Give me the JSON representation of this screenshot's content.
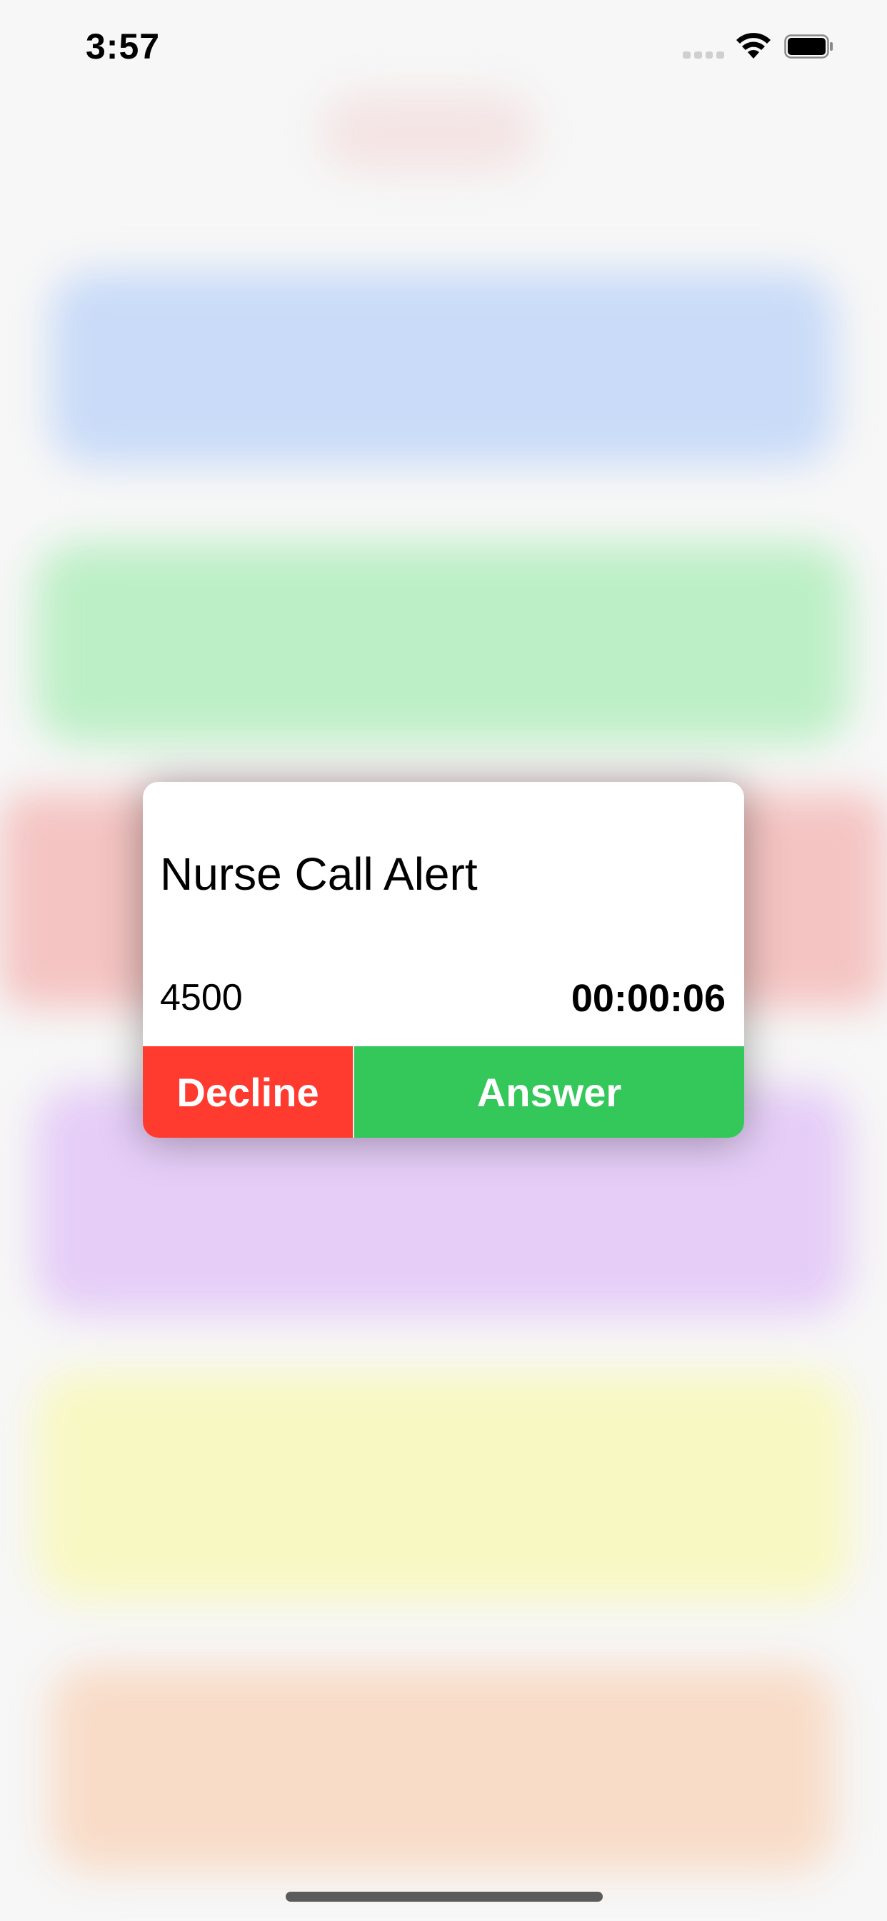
{
  "status_bar": {
    "time": "3:57",
    "icons": [
      "cellular-signal-icon",
      "wifi-icon",
      "battery-icon"
    ]
  },
  "alert": {
    "title": "Nurse Call Alert",
    "extension": "4500",
    "timer": "00:00:06",
    "decline_label": "Decline",
    "answer_label": "Answer"
  },
  "colors": {
    "decline": "#ff3b30",
    "answer": "#34c759",
    "background_blobs": [
      "#c9dbf8",
      "#bdefc6",
      "#f4c4c2",
      "#e5cdf7",
      "#f8f8c3",
      "#f8dcc8"
    ]
  }
}
